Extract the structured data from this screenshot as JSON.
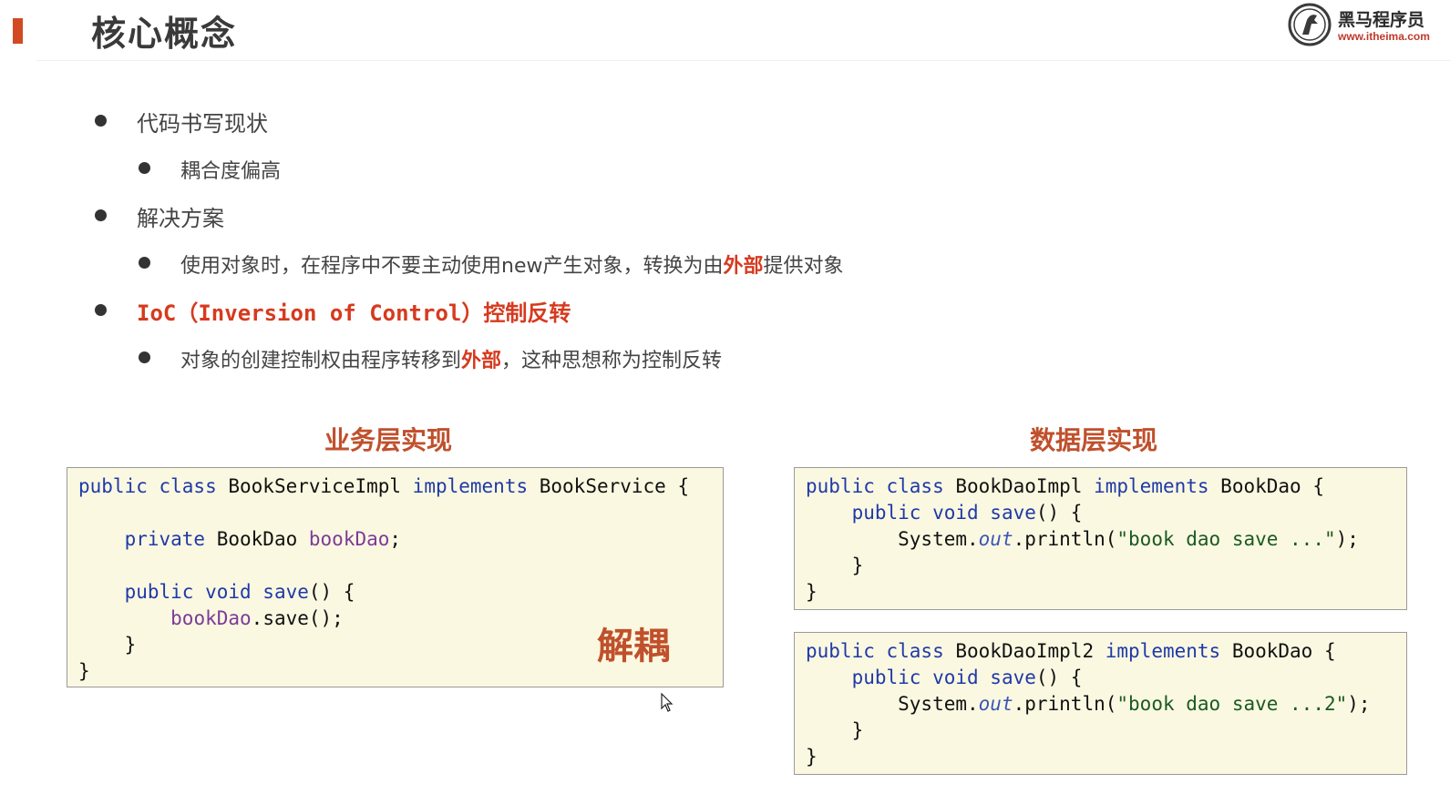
{
  "header": {
    "title": "核心概念",
    "logo_name": "黑马程序员",
    "logo_url": "www.itheima.com"
  },
  "bullets": [
    {
      "level": 1,
      "text": "代码书写现状"
    },
    {
      "level": 2,
      "text": "耦合度偏高"
    },
    {
      "level": 1,
      "text": "解决方案"
    },
    {
      "level": 2,
      "parts": [
        "使用对象时，在程序中不要主动使用new产生对象，转换为由",
        "外部",
        "提供对象"
      ]
    },
    {
      "level": 1,
      "parts": [
        "IoC",
        "（",
        "Inversion of Control",
        "）",
        "控制反转"
      ]
    },
    {
      "level": 2,
      "parts": [
        "对象的创建控制权由程序转移到",
        "外部",
        "，这种思想称为控制反转"
      ]
    }
  ],
  "sections": {
    "business_title": "业务层实现",
    "data_title": "数据层实现",
    "decouple_label": "解耦"
  },
  "code": {
    "service": [
      "public class BookServiceImpl implements BookService {",
      "",
      "    private BookDao bookDao;",
      "",
      "    public void save() {",
      "        bookDao.save();",
      "    }",
      "}"
    ],
    "dao1": [
      "public class BookDaoImpl implements BookDao {",
      "    public void save() {",
      "        System.out.println(\"book dao save ...\");",
      "    }",
      "}"
    ],
    "dao2": [
      "public class BookDaoImpl2 implements BookDao {",
      "    public void save() {",
      "        System.out.println(\"book dao save ...2\");",
      "    }",
      "}"
    ]
  },
  "colors": {
    "accent": "#d14a23",
    "highlight_red": "#d63a1e",
    "section_title": "#c0502c",
    "code_bg": "#fbf8e1",
    "keyword": "#1f3aa8",
    "field": "#7b3b98"
  }
}
